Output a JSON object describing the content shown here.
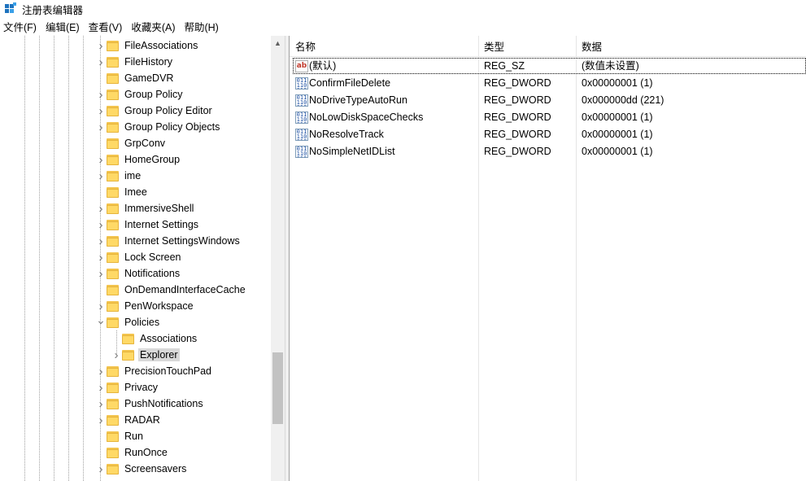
{
  "window": {
    "title": "注册表编辑器"
  },
  "menu": [
    "文件(F)",
    "编辑(E)",
    "查看(V)",
    "收藏夹(A)",
    "帮助(H)"
  ],
  "tree": {
    "nodes": [
      {
        "label": "FileAssociations",
        "level": 0,
        "expander": "collapsed"
      },
      {
        "label": "FileHistory",
        "level": 0,
        "expander": "collapsed"
      },
      {
        "label": "GameDVR",
        "level": 0,
        "expander": "none"
      },
      {
        "label": "Group Policy",
        "level": 0,
        "expander": "collapsed"
      },
      {
        "label": "Group Policy Editor",
        "level": 0,
        "expander": "collapsed"
      },
      {
        "label": "Group Policy Objects",
        "level": 0,
        "expander": "collapsed"
      },
      {
        "label": "GrpConv",
        "level": 0,
        "expander": "none"
      },
      {
        "label": "HomeGroup",
        "level": 0,
        "expander": "collapsed"
      },
      {
        "label": "ime",
        "level": 0,
        "expander": "collapsed"
      },
      {
        "label": "Imee",
        "level": 0,
        "expander": "none"
      },
      {
        "label": "ImmersiveShell",
        "level": 0,
        "expander": "collapsed"
      },
      {
        "label": "Internet Settings",
        "level": 0,
        "expander": "collapsed"
      },
      {
        "label": "Internet SettingsWindows",
        "level": 0,
        "expander": "collapsed"
      },
      {
        "label": "Lock Screen",
        "level": 0,
        "expander": "collapsed"
      },
      {
        "label": "Notifications",
        "level": 0,
        "expander": "collapsed"
      },
      {
        "label": "OnDemandInterfaceCache",
        "level": 0,
        "expander": "none"
      },
      {
        "label": "PenWorkspace",
        "level": 0,
        "expander": "collapsed"
      },
      {
        "label": "Policies",
        "level": 0,
        "expander": "expanded"
      },
      {
        "label": "Associations",
        "level": 1,
        "expander": "none"
      },
      {
        "label": "Explorer",
        "level": 1,
        "expander": "collapsed",
        "selected": true
      },
      {
        "label": "PrecisionTouchPad",
        "level": 0,
        "expander": "collapsed"
      },
      {
        "label": "Privacy",
        "level": 0,
        "expander": "collapsed"
      },
      {
        "label": "PushNotifications",
        "level": 0,
        "expander": "collapsed"
      },
      {
        "label": "RADAR",
        "level": 0,
        "expander": "collapsed"
      },
      {
        "label": "Run",
        "level": 0,
        "expander": "none"
      },
      {
        "label": "RunOnce",
        "level": 0,
        "expander": "none"
      },
      {
        "label": "Screensavers",
        "level": 0,
        "expander": "collapsed"
      }
    ]
  },
  "list": {
    "columns": {
      "name": "名称",
      "type": "类型",
      "data": "数据"
    },
    "rows": [
      {
        "name": "(默认)",
        "type": "REG_SZ",
        "data": "(数值未设置)",
        "icon": "string-value-icon"
      },
      {
        "name": "ConfirmFileDelete",
        "type": "REG_DWORD",
        "data": "0x00000001 (1)",
        "icon": "dword-value-icon"
      },
      {
        "name": "NoDriveTypeAutoRun",
        "type": "REG_DWORD",
        "data": "0x000000dd (221)",
        "icon": "dword-value-icon"
      },
      {
        "name": "NoLowDiskSpaceChecks",
        "type": "REG_DWORD",
        "data": "0x00000001 (1)",
        "icon": "dword-value-icon"
      },
      {
        "name": "NoResolveTrack",
        "type": "REG_DWORD",
        "data": "0x00000001 (1)",
        "icon": "dword-value-icon"
      },
      {
        "name": "NoSimpleNetIDList",
        "type": "REG_DWORD",
        "data": "0x00000001 (1)",
        "icon": "dword-value-icon"
      }
    ]
  },
  "colors": {
    "folder": "#ffd966",
    "selection": "#d9d9d9",
    "titlebar": "#ffffff",
    "scroll_thumb": "#c2c2c2"
  }
}
